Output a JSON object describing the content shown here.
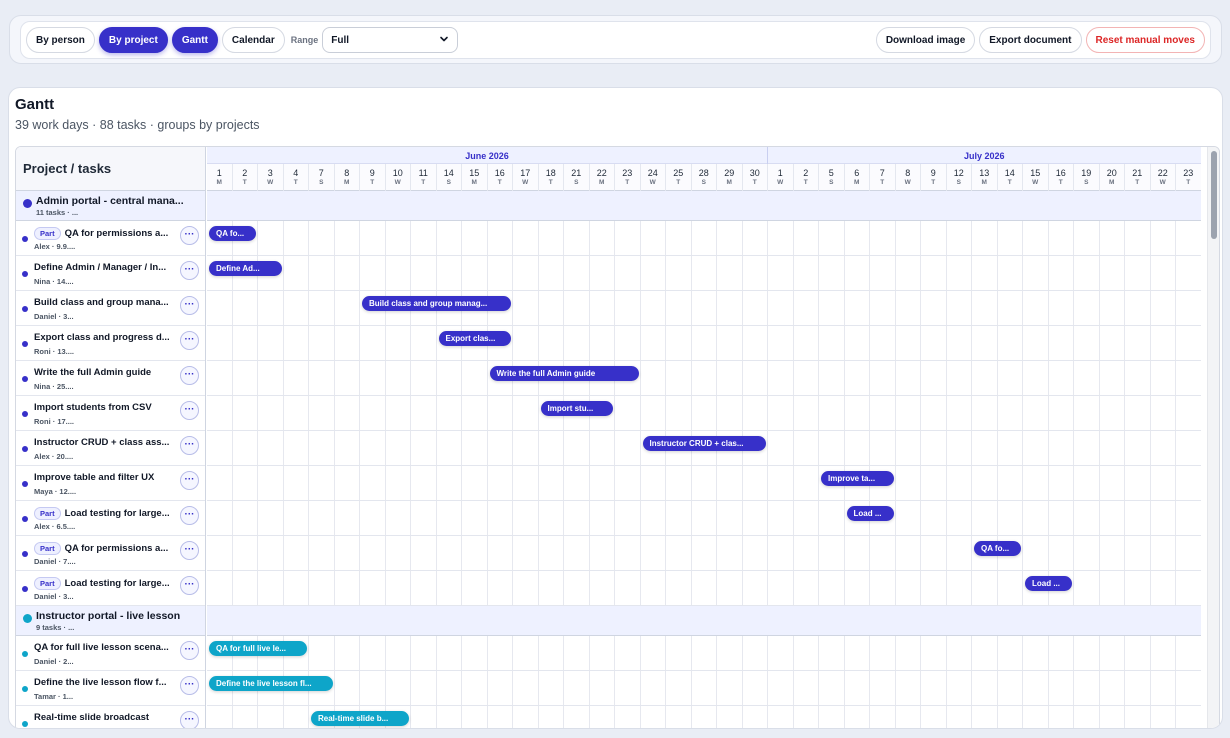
{
  "toolbar": {
    "by_person": "By person",
    "by_project": "By project",
    "gantt": "Gantt",
    "calendar": "Calendar",
    "range_label": "Range",
    "range_value": "Full",
    "download_image": "Download image",
    "export_document": "Export document",
    "reset_moves": "Reset manual moves"
  },
  "header": {
    "title": "Gantt",
    "subtitle": "39 work days · 88 tasks · groups by projects"
  },
  "gantt": {
    "left_header": "Project / tasks",
    "months": [
      {
        "label": "June 2026",
        "days": 22
      },
      {
        "label": "July 2026",
        "days": 17
      }
    ],
    "days": [
      {
        "n": "1",
        "w": "M"
      },
      {
        "n": "2",
        "w": "T"
      },
      {
        "n": "3",
        "w": "W"
      },
      {
        "n": "4",
        "w": "T"
      },
      {
        "n": "7",
        "w": "S"
      },
      {
        "n": "8",
        "w": "M"
      },
      {
        "n": "9",
        "w": "T"
      },
      {
        "n": "10",
        "w": "W"
      },
      {
        "n": "11",
        "w": "T"
      },
      {
        "n": "14",
        "w": "S"
      },
      {
        "n": "15",
        "w": "M"
      },
      {
        "n": "16",
        "w": "T"
      },
      {
        "n": "17",
        "w": "W"
      },
      {
        "n": "18",
        "w": "T"
      },
      {
        "n": "21",
        "w": "S"
      },
      {
        "n": "22",
        "w": "M"
      },
      {
        "n": "23",
        "w": "T"
      },
      {
        "n": "24",
        "w": "W"
      },
      {
        "n": "25",
        "w": "T"
      },
      {
        "n": "28",
        "w": "S"
      },
      {
        "n": "29",
        "w": "M"
      },
      {
        "n": "30",
        "w": "T"
      },
      {
        "n": "1",
        "w": "W"
      },
      {
        "n": "2",
        "w": "T"
      },
      {
        "n": "5",
        "w": "S"
      },
      {
        "n": "6",
        "w": "M"
      },
      {
        "n": "7",
        "w": "T"
      },
      {
        "n": "8",
        "w": "W"
      },
      {
        "n": "9",
        "w": "T"
      },
      {
        "n": "12",
        "w": "S"
      },
      {
        "n": "13",
        "w": "M"
      },
      {
        "n": "14",
        "w": "T"
      },
      {
        "n": "15",
        "w": "W"
      },
      {
        "n": "16",
        "w": "T"
      },
      {
        "n": "19",
        "w": "S"
      },
      {
        "n": "20",
        "w": "M"
      },
      {
        "n": "21",
        "w": "T"
      },
      {
        "n": "22",
        "w": "W"
      },
      {
        "n": "23",
        "w": "T"
      }
    ],
    "groups": [
      {
        "title": "Admin portal - central mana...",
        "subtitle": "11 tasks · ...",
        "color": "#3730c9",
        "tasks": [
          {
            "badge": "Part",
            "title": "QA for permissions a...",
            "sub": "Alex · 9.9....",
            "bar": "QA fo...",
            "start": 0,
            "len": 1.85
          },
          {
            "badge": "",
            "title": "Define Admin / Manager / In...",
            "sub": "Nina · 14....",
            "bar": "Define Ad...",
            "start": 0,
            "len": 2.85
          },
          {
            "badge": "",
            "title": "Build class and group mana...",
            "sub": "Daniel · 3...",
            "bar": "Build class and group manag...",
            "start": 6,
            "len": 5.85
          },
          {
            "badge": "",
            "title": "Export class and progress d...",
            "sub": "Roni · 13....",
            "bar": "Export clas...",
            "start": 9,
            "len": 2.85
          },
          {
            "badge": "",
            "title": "Write the full Admin guide",
            "sub": "Nina · 25....",
            "bar": "Write the full Admin guide",
            "start": 11,
            "len": 5.85
          },
          {
            "badge": "",
            "title": "Import students from CSV",
            "sub": "Roni · 17....",
            "bar": "Import stu...",
            "start": 13,
            "len": 2.85
          },
          {
            "badge": "",
            "title": "Instructor CRUD + class ass...",
            "sub": "Alex · 20....",
            "bar": "Instructor CRUD + clas...",
            "start": 17,
            "len": 4.85
          },
          {
            "badge": "",
            "title": "Improve table and filter UX",
            "sub": "Maya · 12....",
            "bar": "Improve ta...",
            "start": 24,
            "len": 2.85
          },
          {
            "badge": "Part",
            "title": "Load testing for large...",
            "sub": "Alex · 6.5....",
            "bar": "Load ...",
            "start": 25,
            "len": 1.85
          },
          {
            "badge": "Part",
            "title": "QA for permissions a...",
            "sub": "Daniel · 7....",
            "bar": "QA fo...",
            "start": 30,
            "len": 1.85
          },
          {
            "badge": "Part",
            "title": "Load testing for large...",
            "sub": "Daniel · 3...",
            "bar": "Load ...",
            "start": 32,
            "len": 1.85
          }
        ]
      },
      {
        "title": "Instructor portal - live lesson",
        "subtitle": "9 tasks · ...",
        "color": "#0ea5c9",
        "tasks": [
          {
            "badge": "",
            "title": "QA for full live lesson scena...",
            "sub": "Daniel · 2...",
            "bar": "QA for full live le...",
            "start": 0,
            "len": 3.85
          },
          {
            "badge": "",
            "title": "Define the live lesson flow f...",
            "sub": "Tamar · 1...",
            "bar": "Define the live lesson fl...",
            "start": 0,
            "len": 4.85
          },
          {
            "badge": "",
            "title": "Real-time slide broadcast",
            "sub": "",
            "bar": "Real-time slide b...",
            "start": 4,
            "len": 3.85
          }
        ]
      }
    ]
  }
}
